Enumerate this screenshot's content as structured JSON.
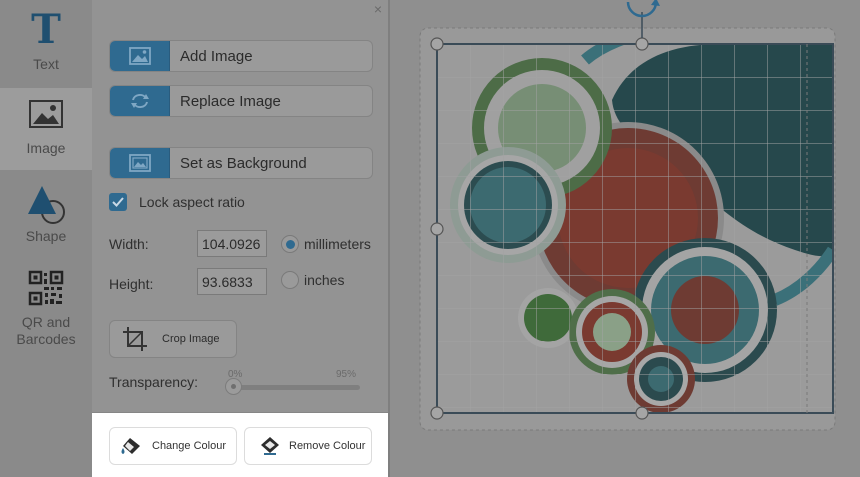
{
  "rail": {
    "items": [
      {
        "label": "Text",
        "icon": "text-tool-icon"
      },
      {
        "label": "Image",
        "icon": "image-tool-icon"
      },
      {
        "label": "Shape",
        "icon": "shape-tool-icon"
      },
      {
        "label_line1": "QR and",
        "label_line2": "Barcodes",
        "icon": "qr-code-icon"
      }
    ],
    "text_glyph": "T",
    "active": "Image"
  },
  "panel": {
    "close_glyph": "×",
    "add_image": "Add Image",
    "replace_image": "Replace Image",
    "set_background": "Set as Background",
    "lock_aspect_label": "Lock aspect ratio",
    "lock_aspect_checked": true,
    "width_label": "Width:",
    "width_value": "104.0926",
    "height_label": "Height:",
    "height_value": "93.6833",
    "unit_millimeters": "millimeters",
    "unit_inches": "inches",
    "selected_unit": "millimeters",
    "crop_image": "Crop Image",
    "transparency_label": "Transparency:",
    "transparency_min": "0%",
    "transparency_max": "95%",
    "transparency_value": 0,
    "change_colour": "Change Colour",
    "remove_colour": "Remove Colour"
  },
  "colors": {
    "accent": "#2f6a90",
    "overlay_dim": "#8e8e8e",
    "highlight_bar": "#ffffff"
  }
}
